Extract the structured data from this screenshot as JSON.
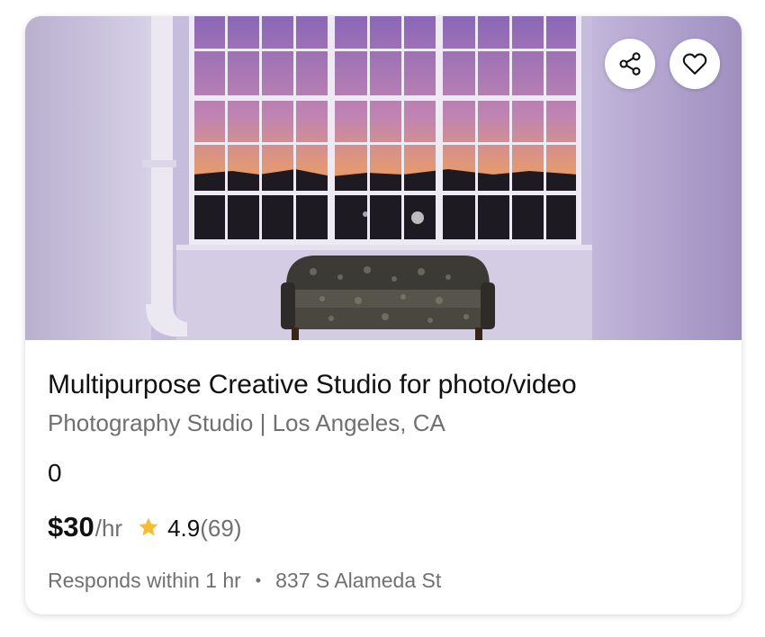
{
  "listing": {
    "title": "Multipurpose Creative Studio for photo/video",
    "subtitle": "Photography Studio | Los Angeles, CA",
    "count": "0",
    "price": "$30",
    "price_unit": "/hr",
    "rating": "4.9",
    "reviews": "(69)",
    "response_time": "Responds within 1 hr",
    "separator": "•",
    "address": "837 S Alameda St"
  },
  "icons": {
    "share": "share-icon",
    "favorite": "heart-icon",
    "rating": "star-icon"
  },
  "colors": {
    "star": "#F5BD2F",
    "muted_text": "#707070",
    "primary_text": "#111111"
  }
}
